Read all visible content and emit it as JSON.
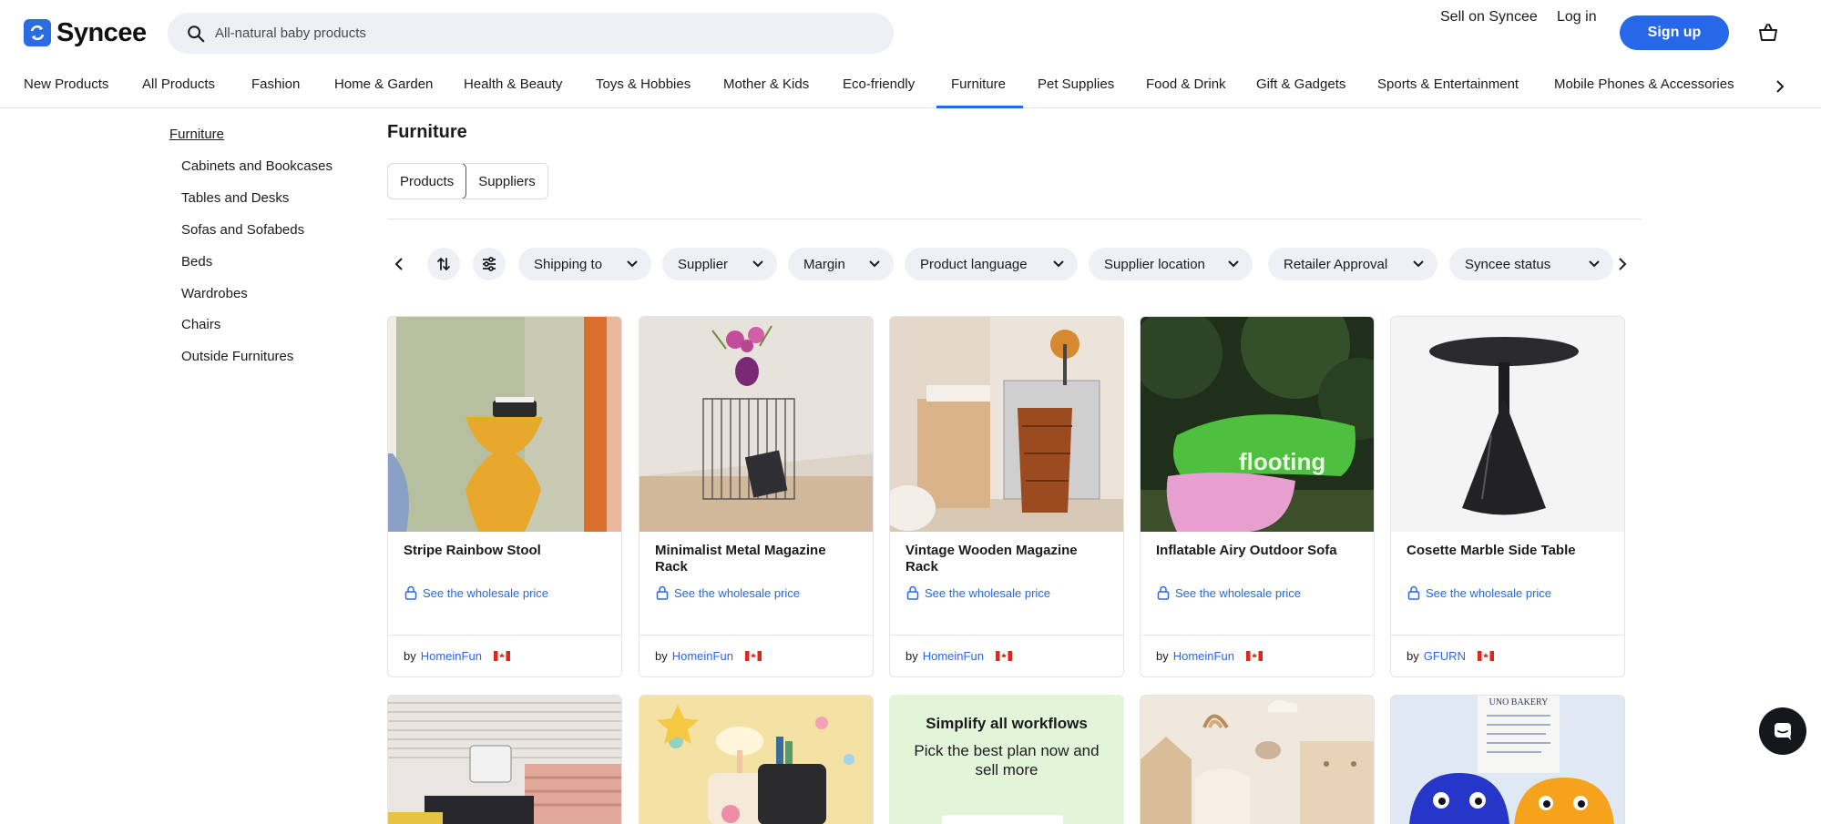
{
  "brand": {
    "name": "Syncee",
    "accent": "#2668e8"
  },
  "search": {
    "placeholder": "All-natural baby products"
  },
  "header": {
    "sell_label": "Sell on Syncee",
    "login_label": "Log in",
    "signup_label": "Sign up"
  },
  "categories": [
    "New Products",
    "All Products",
    "Fashion",
    "Home & Garden",
    "Health & Beauty",
    "Toys & Hobbies",
    "Mother & Kids",
    "Eco-friendly",
    "Furniture",
    "Pet Supplies",
    "Food & Drink",
    "Gift & Gadgets",
    "Sports & Entertainment",
    "Mobile Phones & Accessories"
  ],
  "active_category": "Furniture",
  "sidebar": {
    "root": "Furniture",
    "items": [
      "Cabinets and Bookcases",
      "Tables and Desks",
      "Sofas and Sofabeds",
      "Beds",
      "Wardrobes",
      "Chairs",
      "Outside Furnitures"
    ]
  },
  "main": {
    "title": "Furniture",
    "tabs": [
      "Products",
      "Suppliers"
    ],
    "selected_tab": "Products"
  },
  "filters": [
    "Shipping to",
    "Supplier",
    "Margin",
    "Product language",
    "Supplier location",
    "Retailer Approval",
    "Syncee status"
  ],
  "products": [
    {
      "name": "Stripe Rainbow Stool",
      "price_label": "See the wholesale price",
      "by": "by",
      "supplier": "HomeinFun",
      "flag": "CA"
    },
    {
      "name": "Minimalist Metal Magazine Rack",
      "price_label": "See the wholesale price",
      "by": "by",
      "supplier": "HomeinFun",
      "flag": "CA"
    },
    {
      "name": "Vintage Wooden Magazine Rack",
      "price_label": "See the wholesale price",
      "by": "by",
      "supplier": "HomeinFun",
      "flag": "CA"
    },
    {
      "name": "Inflatable Airy Outdoor Sofa",
      "price_label": "See the wholesale price",
      "by": "by",
      "supplier": "HomeinFun",
      "flag": "CA"
    },
    {
      "name": "Cosette Marble Side Table",
      "price_label": "See the wholesale price",
      "by": "by",
      "supplier": "GFURN",
      "flag": "CA"
    }
  ],
  "promo": {
    "headline": "Simplify all workflows",
    "text": "Pick the best plan now and sell more"
  },
  "product_image_texts": {
    "sofa_brand": "flooting",
    "bakery_sign": "UNO BAKERY"
  }
}
